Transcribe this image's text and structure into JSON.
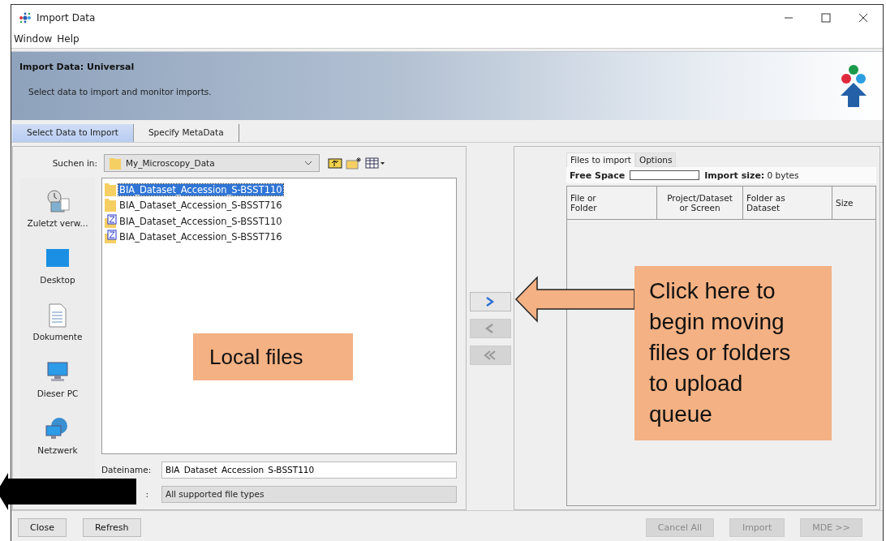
{
  "window": {
    "title": "Import Data"
  },
  "menu": [
    {
      "label": "Window"
    },
    {
      "label": "Help"
    }
  ],
  "header": {
    "title": "Import Data: Universal",
    "subtitle": "Select data to import and monitor imports."
  },
  "tabs": [
    {
      "label": "Select Data to Import",
      "selected": true
    },
    {
      "label": "Specify MetaData",
      "selected": false
    }
  ],
  "chooser": {
    "look_in_label": "Suchen in:",
    "look_in_value": "My_Microscopy_Data",
    "places": [
      {
        "label": "Zuletzt verw...",
        "kind": "recent"
      },
      {
        "label": "Desktop",
        "kind": "desktop"
      },
      {
        "label": "Dokumente",
        "kind": "documents"
      },
      {
        "label": "Dieser PC",
        "kind": "pc"
      },
      {
        "label": "Netzwerk",
        "kind": "network"
      }
    ],
    "files": [
      {
        "name": "BIA_Dataset_Accession_S-BSST110",
        "kind": "folder",
        "selected": true
      },
      {
        "name": "BIA_Dataset_Accession_S-BSST716",
        "kind": "folder",
        "selected": false
      },
      {
        "name": "BIA_Dataset_Accession_S-BSST110",
        "kind": "archive",
        "selected": false
      },
      {
        "name": "BIA_Dataset_Accession_S-BSST716",
        "kind": "archive",
        "selected": false
      }
    ],
    "filename_label": "Dateiname:",
    "filename_value": "BIA_Dataset_Accession_S-BSST110",
    "filetype_label": ":",
    "filetype_value": "All supported file types"
  },
  "transfer_buttons": [
    {
      "kind": "add",
      "disabled": false
    },
    {
      "kind": "remove",
      "disabled": true
    },
    {
      "kind": "remove_all",
      "disabled": true
    }
  ],
  "queue": {
    "tabs": [
      {
        "label": "Files to import",
        "selected": true
      },
      {
        "label": "Options",
        "selected": false
      }
    ],
    "free_space_label": "Free Space",
    "import_size_label": "Import size:",
    "import_size_value": "0 bytes",
    "columns": [
      "File or\nFolder",
      "Project/Dataset\nor Screen",
      "Folder as\nDataset",
      "Size"
    ]
  },
  "footer_left": [
    {
      "label": "Close",
      "disabled": false
    },
    {
      "label": "Refresh",
      "disabled": false
    }
  ],
  "footer_right": [
    {
      "label": "Cancel All",
      "disabled": true
    },
    {
      "label": "Import",
      "disabled": true
    },
    {
      "label": "MDE >>",
      "disabled": true
    }
  ],
  "annotations": [
    {
      "kind": "label",
      "text": "Local files"
    },
    {
      "kind": "callout",
      "text": "Click here to begin moving files or folders to upload queue"
    },
    {
      "kind": "arrow"
    }
  ]
}
